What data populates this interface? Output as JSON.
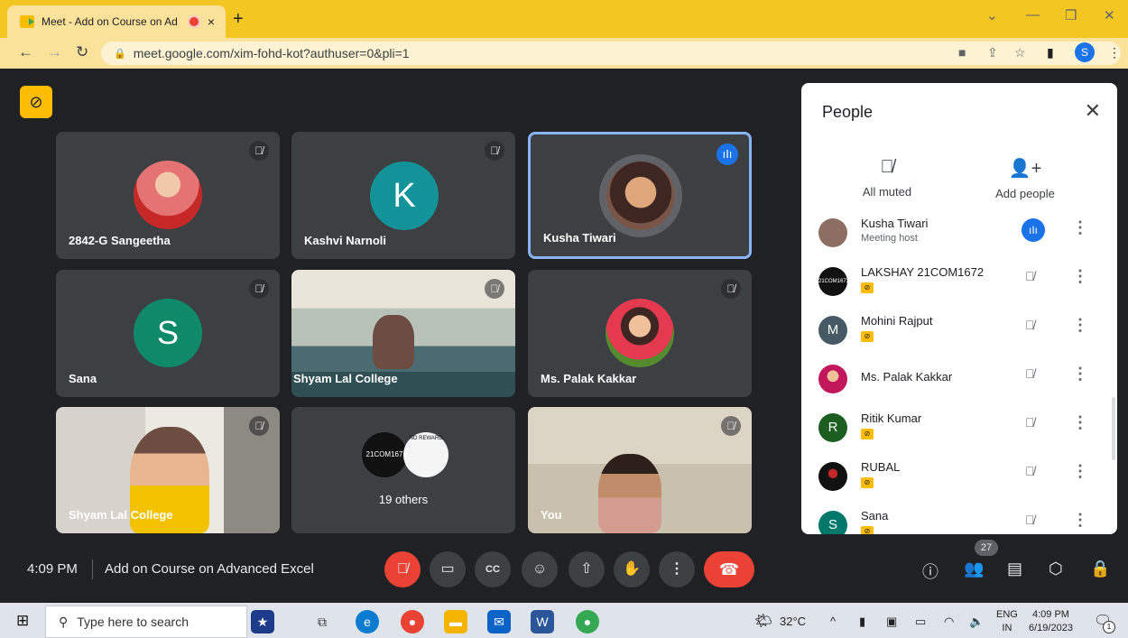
{
  "browser": {
    "tab_title": "Meet - Add on Course on Ad",
    "tab_close": "×",
    "new_tab": "+",
    "url": "meet.google.com/xim-fohd-kot?authuser=0&pli=1",
    "profile_initial": "S"
  },
  "tiles": [
    {
      "name": "2842-G Sangeetha"
    },
    {
      "name": "Kashvi Narnoli",
      "initial": "K"
    },
    {
      "name": "Kusha Tiwari"
    },
    {
      "name": "Sana",
      "initial": "S"
    },
    {
      "name": "Shyam Lal College"
    },
    {
      "name": "Ms. Palak Kakkar"
    },
    {
      "name": "Shyam Lal College"
    },
    {
      "name": "19 others",
      "avatar_text": "21COM167",
      "avatar2_text": "NO REWARD"
    },
    {
      "name": "You"
    }
  ],
  "meeting": {
    "time": "4:09 PM",
    "title": "Add on Course on Advanced Excel",
    "participant_count": "27"
  },
  "people_panel": {
    "title": "People",
    "actions": [
      {
        "label": "All muted"
      },
      {
        "label": "Add people"
      }
    ],
    "participants": [
      {
        "name": "Kusha Tiwari",
        "subtitle": "Meeting host",
        "avatar_color": "#8d6e63"
      },
      {
        "name": "LAKSHAY 21COM1672",
        "avatar_text": "21COM1672",
        "avatar_color": "#111111"
      },
      {
        "name": "Mohini Rajput",
        "initial": "M",
        "avatar_color": "#455a64"
      },
      {
        "name": "Ms. Palak Kakkar",
        "avatar_color": "#c2185b"
      },
      {
        "name": "Ritik Kumar",
        "initial": "R",
        "avatar_color": "#1b5e20"
      },
      {
        "name": "RUBAL",
        "avatar_color": "#111111"
      },
      {
        "name": "Sana",
        "initial": "S",
        "avatar_color": "#00796b"
      }
    ]
  },
  "taskbar": {
    "search_placeholder": "Type here to search",
    "weather": "32°C",
    "lang1": "ENG",
    "lang2": "IN",
    "time": "4:09 PM",
    "date": "6/19/2023",
    "notifications": "1"
  },
  "colors": {
    "meet_bg": "#202124",
    "tile_bg": "#3c4043",
    "accent_blue": "#1a73e8",
    "end_call_red": "#ea4335",
    "chrome_yellow": "#f3c622"
  }
}
